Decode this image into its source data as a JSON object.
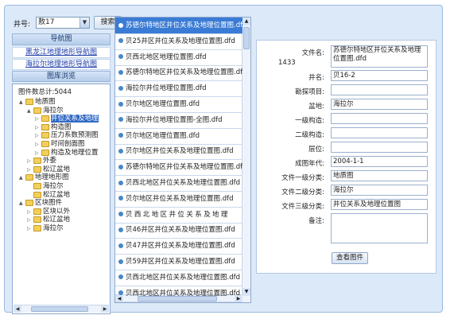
{
  "toolbar": {
    "well_label": "井号:",
    "well_value": "敖17",
    "search_label": "搜索"
  },
  "nav": {
    "header": "导航图",
    "links": [
      "黑龙江地理地形导航图",
      "海拉尔地理地形导航图"
    ]
  },
  "browse": {
    "header": "图库浏览",
    "total": "图件数总计:5044"
  },
  "tree": [
    {
      "label": "地质图",
      "level": 0,
      "toggle": "▲"
    },
    {
      "label": "海拉尔",
      "level": 1,
      "toggle": "▲"
    },
    {
      "label": "井位关系及地理",
      "level": 2,
      "toggle": "▷",
      "selected": true
    },
    {
      "label": "构造图",
      "level": 2,
      "toggle": "▷"
    },
    {
      "label": "压力系数预测图",
      "level": 2,
      "toggle": "▷"
    },
    {
      "label": "时间剖面图",
      "level": 2,
      "toggle": "▷"
    },
    {
      "label": "构造及地理位置",
      "level": 2,
      "toggle": "▷"
    },
    {
      "label": "外委",
      "level": 1,
      "toggle": "▷"
    },
    {
      "label": "松辽盆地",
      "level": 1,
      "toggle": "▷"
    },
    {
      "label": "地理地形图",
      "level": 0,
      "toggle": "▲"
    },
    {
      "label": "海拉尔",
      "level": 1,
      "toggle": ""
    },
    {
      "label": "松辽盆地",
      "level": 1,
      "toggle": ""
    },
    {
      "label": "区块图件",
      "level": 0,
      "toggle": "▲"
    },
    {
      "label": "区块以外",
      "level": 1,
      "toggle": "▷"
    },
    {
      "label": "松辽盆地",
      "level": 1,
      "toggle": "▷"
    },
    {
      "label": "海拉尔",
      "level": 1,
      "toggle": "▷"
    }
  ],
  "file_list": [
    {
      "name": "苏德尔特地区井位关系及地理位置图.dfd",
      "selected": true
    },
    {
      "name": "贝25井区井位关系及地理位置图.dfd"
    },
    {
      "name": "贝西北地区地理位置图.dfd"
    },
    {
      "name": "苏德尔特地区井位关系及地理位置图.dfd"
    },
    {
      "name": "海拉尔井位地理位置图.dfd"
    },
    {
      "name": "贝尔地区地理位置图.dfd"
    },
    {
      "name": "海拉尔井位地理位置图-全图.dfd"
    },
    {
      "name": "贝尔地区地理位置图.dfd"
    },
    {
      "name": "贝尔地区井位关系及地理位置图.dfd"
    },
    {
      "name": "苏德尔特地区井位关系及地理位置图.dfd"
    },
    {
      "name": "贝西北地区井位关系及地理位置图.dfd"
    },
    {
      "name": "贝尔地区井位关系及地理位置图.dfd"
    },
    {
      "name": "贝西北地区井位关系及地理",
      "spaced": true
    },
    {
      "name": "贝46井区井位关系及地理位置图.dfd"
    },
    {
      "name": "贝47井区井位关系及地理位置图.dfd"
    },
    {
      "name": "贝59井区井位关系及地理位置图.dfd"
    },
    {
      "name": "贝西北地区井位关系及地理位置图.dfd"
    },
    {
      "name": "贝西北地区井位关系及地理位置图.dfd"
    }
  ],
  "detail": {
    "count": "1433",
    "fields": [
      {
        "label": "文件名:",
        "value": "苏德尔特地区井位关系及地理位置图.dfd",
        "tall": true
      },
      {
        "label": "井名:",
        "value": "贝16-2"
      },
      {
        "label": "勘探项目:",
        "value": ""
      },
      {
        "label": "盆地:",
        "value": "海拉尔"
      },
      {
        "label": "一级构造:",
        "value": ""
      },
      {
        "label": "二级构造:",
        "value": ""
      },
      {
        "label": "层位:",
        "value": ""
      },
      {
        "label": "成图年代:",
        "value": "2004-1-1"
      },
      {
        "label": "文件一级分类:",
        "value": "地质图"
      },
      {
        "label": "文件二级分类:",
        "value": "海拉尔"
      },
      {
        "label": "文件三级分类:",
        "value": "井位关系及地理位置图"
      },
      {
        "label": "备注:",
        "value": "",
        "area": true
      }
    ],
    "view_button": "查看图件"
  },
  "colors": {
    "frame": "#dce9f8",
    "selection": "#3a7bd5",
    "link": "#1a3aa8"
  }
}
